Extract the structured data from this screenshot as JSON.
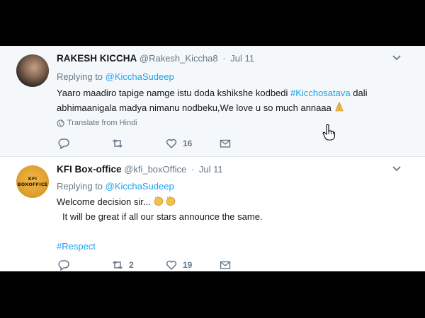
{
  "tweets": [
    {
      "display_name": "RAKESH KICCHA",
      "handle": "@Rakesh_Kiccha8",
      "date": "Jul 11",
      "replying_label": "Replying to",
      "replying_to": "@KicchaSudeep",
      "line1_text": "Yaaro maadiro tapige namge istu doda kshikshe kodbedi",
      "line1_hashtag": "#Kicchosatava",
      "line1_after": "dali",
      "line2_text": "abhimaanigala madya nimanu nodbeku,We love u so much annaaa",
      "translate": "Translate from Hindi",
      "likes": "16"
    },
    {
      "display_name": "KFI Box-office",
      "handle": "@kfi_boxOffice",
      "date": "Jul 11",
      "avatar_text_line1": "KFI",
      "avatar_text_line2": "BOXOFFICE",
      "replying_label": "Replying to",
      "replying_to": "@KicchaSudeep",
      "line1_text": "Welcome decision sir...",
      "line2_text": "It will be great if all our stars announce the same.",
      "hashtag": "#Respect",
      "retweets": "2",
      "likes": "19"
    }
  ],
  "icons": [
    "chevron-down-icon",
    "globe-icon",
    "reply-icon",
    "retweet-icon",
    "like-icon",
    "dm-icon",
    "folded-hands-emoji",
    "clapping-hands-emoji",
    "hand-cursor-icon"
  ],
  "colors": {
    "link": "#1da1f2",
    "muted": "#657786",
    "text": "#14171a",
    "highlight_bg": "#f5f8fa"
  }
}
